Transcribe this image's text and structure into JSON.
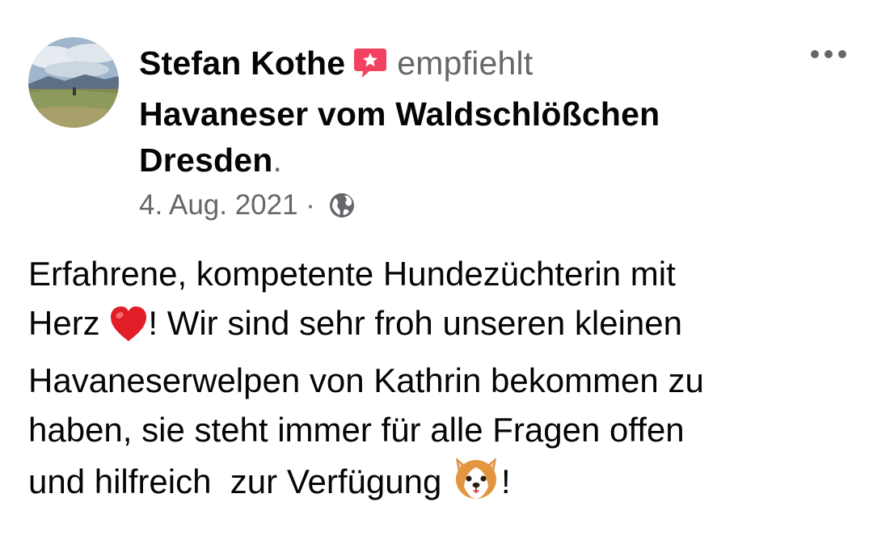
{
  "post": {
    "author_name": "Stefan Kothe",
    "action_text": "empfiehlt",
    "page_name": "Havaneser vom Waldschlößchen Dresden",
    "trailing_period": ".",
    "date": "4. Aug. 2021",
    "separator": " · ",
    "privacy_icon": "globe-icon",
    "recommend_icon": "recommendation-badge-icon",
    "more_icon": "more-options-icon",
    "text_line1": "Erfahrene, kompetente Hundezüchterin mit",
    "text_line2a": "Herz ",
    "text_line2b": "! Wir sind sehr froh unseren kleinen",
    "text_line3": "Havaneserwelpen von Kathrin bekommen zu",
    "text_line4": "haben, sie steht immer für alle Fragen offen",
    "text_line5a": "und hilfreich  zur Verfügung ",
    "text_line5b": "!",
    "emoji_heart": "heart-emoji",
    "emoji_dog": "dog-face-emoji"
  },
  "colors": {
    "recommend_badge": "#f3425f",
    "secondary_text": "#65676b",
    "primary_text": "#050505"
  }
}
